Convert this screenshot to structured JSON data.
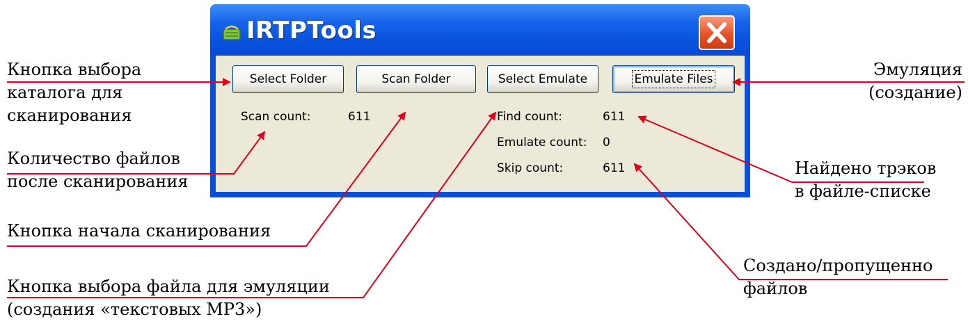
{
  "window": {
    "title": "IRTPTools",
    "buttons": {
      "select_folder": "Select Folder",
      "scan_folder": "Scan Folder",
      "select_emulate": "Select Emulate",
      "emulate_files": "Emulate Files"
    },
    "stats": {
      "scan_count_label": "Scan count:",
      "scan_count_value": "611",
      "find_count_label": "Find count:",
      "find_count_value": "611",
      "emulate_count_label": "Emulate count:",
      "emulate_count_value": "0",
      "skip_count_label": "Skip count:",
      "skip_count_value": "611"
    }
  },
  "annotations": {
    "select_folder_button": [
      "Кнопка выбора",
      "каталога для",
      "сканирования"
    ],
    "files_after_scan": [
      "Количество файлов",
      "после сканирования"
    ],
    "scan_start_button": "Кнопка начала сканирования",
    "select_emulate_file": [
      "Кнопка выбора файла для эмуляции",
      "(создания «текстовых MP3»)"
    ],
    "emulation": [
      "Эмуляция",
      "(создание)"
    ],
    "tracks_found": [
      "Найдено трэков",
      "в файле-списке"
    ],
    "created_skipped": [
      "Создано/пропущенно",
      "файлов"
    ]
  },
  "colors": {
    "arrow": "#e0001a",
    "titlebar": "#0a53de",
    "client": "#ece9d8",
    "close_button": "#e6532b"
  }
}
